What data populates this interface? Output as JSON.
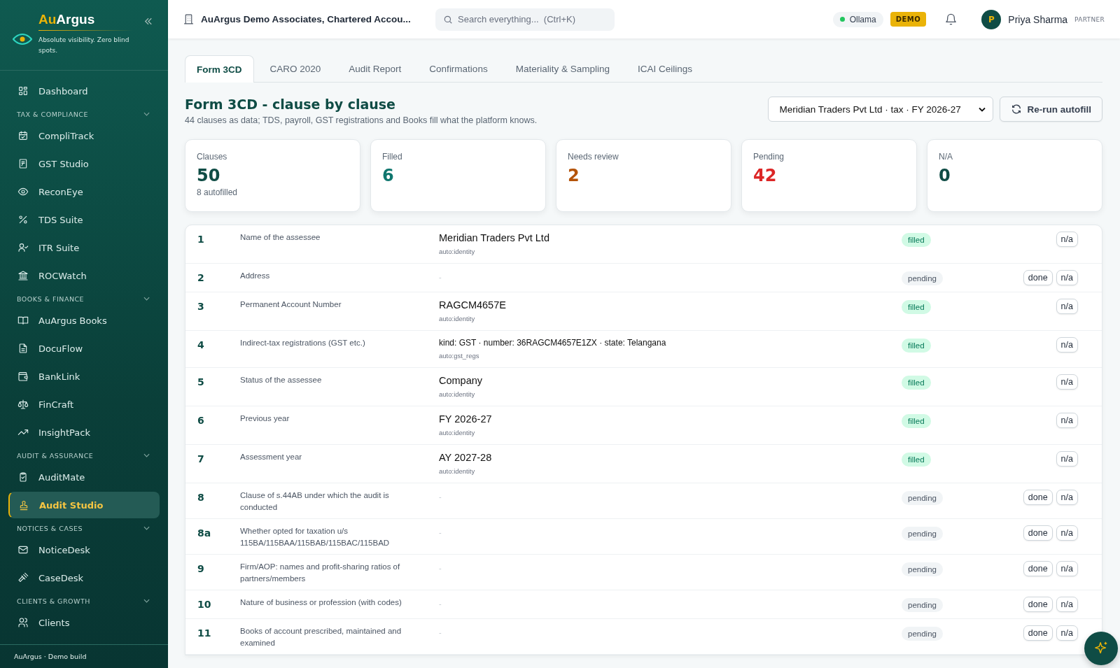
{
  "sidebar": {
    "brand": {
      "part_1": "Au",
      "part_2": "Argus"
    },
    "tagline": "Absolute visibility. Zero blind spots.",
    "items": [
      {
        "label": "Dashboard",
        "selected": false
      }
    ],
    "sections": [
      {
        "title": "TAX & COMPLIANCE",
        "expanded": true,
        "items": [
          {
            "label": "CompliTrack",
            "selected": false
          },
          {
            "label": "GST Studio",
            "selected": false
          },
          {
            "label": "ReconEye",
            "selected": false
          },
          {
            "label": "TDS Suite",
            "selected": false
          },
          {
            "label": "ITR Suite",
            "selected": false
          },
          {
            "label": "ROCWatch",
            "selected": false
          }
        ]
      },
      {
        "title": "BOOKS & FINANCE",
        "expanded": true,
        "items": [
          {
            "label": "AuArgus Books",
            "selected": false
          },
          {
            "label": "DocuFlow",
            "selected": false
          },
          {
            "label": "BankLink",
            "selected": false
          },
          {
            "label": "FinCraft",
            "selected": false
          },
          {
            "label": "InsightPack",
            "selected": false
          }
        ]
      },
      {
        "title": "AUDIT & ASSURANCE",
        "expanded": true,
        "items": [
          {
            "label": "AuditMate",
            "selected": false
          },
          {
            "label": "Audit Studio",
            "selected": true
          }
        ]
      },
      {
        "title": "NOTICES & CASES",
        "expanded": true,
        "items": [
          {
            "label": "NoticeDesk",
            "selected": false
          },
          {
            "label": "CaseDesk",
            "selected": false
          }
        ]
      },
      {
        "title": "CLIENTS & GROWTH",
        "expanded": true,
        "items": [
          {
            "label": "Clients",
            "selected": false
          }
        ]
      }
    ],
    "footer": "AuArgus · Demo build"
  },
  "topbar": {
    "firm": "AuArgus Demo Associates, Chartered Accou...",
    "search": {
      "placeholder": "Search everything...  (Ctrl+K)"
    },
    "model": {
      "label": "Ollama",
      "color": "#22c55e"
    },
    "badge": "DEMO",
    "user": {
      "initial": "P",
      "name": "Priya Sharma",
      "role": "PARTNER"
    }
  },
  "tabs": [
    {
      "label": "Form 3CD",
      "selected": true
    },
    {
      "label": "CARO 2020",
      "selected": false
    },
    {
      "label": "Audit Report",
      "selected": false
    },
    {
      "label": "Confirmations",
      "selected": false
    },
    {
      "label": "Materiality & Sampling",
      "selected": false
    },
    {
      "label": "ICAI Ceilings",
      "selected": false
    }
  ],
  "heading": {
    "title": "Form 3CD - clause by clause",
    "subtitle": "44 clauses as data; TDS, payroll, GST registrations and Books fill what the platform knows."
  },
  "engagement_select": {
    "value": "Meridian Traders Pvt Ltd · tax · FY 2026-27"
  },
  "rerun_button": "Re-run autofill",
  "stats": [
    {
      "label": "Clauses",
      "value": "50",
      "note": "8 autofilled",
      "color": "#0f4c45"
    },
    {
      "label": "Filled",
      "value": "6",
      "color": "#0f766e"
    },
    {
      "label": "Needs review",
      "value": "2",
      "color": "#b45309"
    },
    {
      "label": "Pending",
      "value": "42",
      "color": "#dc2626"
    },
    {
      "label": "N/A",
      "value": "0",
      "color": "#0f4c45"
    }
  ],
  "clauses": [
    {
      "number": "1",
      "title": "Name of the assessee",
      "value": "Meridian Traders Pvt Ltd",
      "kind": "large",
      "source": "auto:identity",
      "status": {
        "label": "filled",
        "kind": "filled"
      },
      "actions": [
        "n/a"
      ]
    },
    {
      "number": "2",
      "title": "Address",
      "value": "-",
      "kind": "empty",
      "status": {
        "label": "pending",
        "kind": "pending"
      },
      "actions": [
        "done",
        "n/a"
      ]
    },
    {
      "number": "3",
      "title": "Permanent Account Number",
      "value": "RAGCM4657E",
      "kind": "large",
      "source": "auto:identity",
      "status": {
        "label": "filled",
        "kind": "filled"
      },
      "actions": [
        "n/a"
      ]
    },
    {
      "number": "4",
      "title": "Indirect-tax registrations (GST etc.)",
      "value": "kind: GST · number: 36RAGCM4657E1ZX · state: Telangana",
      "kind": "small",
      "source": "auto:gst_regs",
      "status": {
        "label": "filled",
        "kind": "filled"
      },
      "actions": [
        "n/a"
      ]
    },
    {
      "number": "5",
      "title": "Status of the assessee",
      "value": "Company",
      "kind": "large",
      "source": "auto:identity",
      "status": {
        "label": "filled",
        "kind": "filled"
      },
      "actions": [
        "n/a"
      ]
    },
    {
      "number": "6",
      "title": "Previous year",
      "value": "FY 2026-27",
      "kind": "large",
      "source": "auto:identity",
      "status": {
        "label": "filled",
        "kind": "filled"
      },
      "actions": [
        "n/a"
      ]
    },
    {
      "number": "7",
      "title": "Assessment year",
      "value": "AY 2027-28",
      "kind": "large",
      "source": "auto:identity",
      "status": {
        "label": "filled",
        "kind": "filled"
      },
      "actions": [
        "n/a"
      ]
    },
    {
      "number": "8",
      "title": "Clause of s.44AB under which the audit is conducted",
      "value": "-",
      "kind": "empty",
      "status": {
        "label": "pending",
        "kind": "pending"
      },
      "actions": [
        "done",
        "n/a"
      ]
    },
    {
      "number": "8a",
      "title": "Whether opted for taxation u/s 115BA/115BAA/115BAB/115BAC/115BAD",
      "value": "-",
      "kind": "empty",
      "status": {
        "label": "pending",
        "kind": "pending"
      },
      "actions": [
        "done",
        "n/a"
      ]
    },
    {
      "number": "9",
      "title": "Firm/AOP: names and profit-sharing ratios of partners/members",
      "value": "-",
      "kind": "empty",
      "status": {
        "label": "pending",
        "kind": "pending"
      },
      "actions": [
        "done",
        "n/a"
      ]
    },
    {
      "number": "10",
      "title": "Nature of business or profession (with codes)",
      "value": "-",
      "kind": "empty",
      "status": {
        "label": "pending",
        "kind": "pending"
      },
      "actions": [
        "done",
        "n/a"
      ]
    },
    {
      "number": "11",
      "title": "Books of account prescribed, maintained and examined",
      "value": "-",
      "kind": "empty",
      "status": {
        "label": "pending",
        "kind": "pending"
      },
      "actions": [
        "done",
        "n/a"
      ]
    }
  ]
}
